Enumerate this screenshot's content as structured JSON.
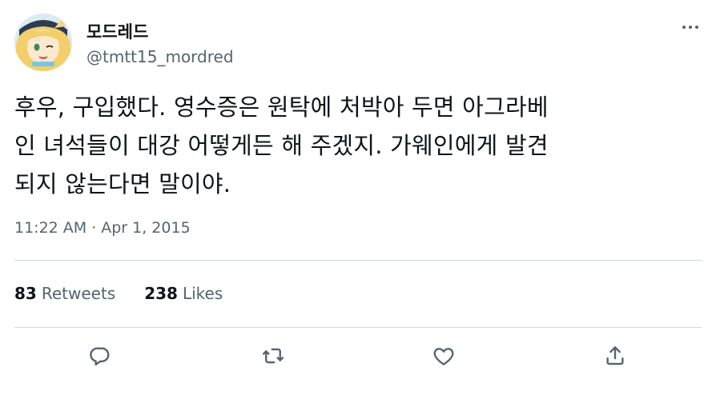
{
  "author": {
    "display_name": "모드레드",
    "handle": "@tmtt15_mordred"
  },
  "tweet": {
    "text_lines": [
      "후우, 구입했다. 영수증은 원탁에 처박아 두면 아그라베",
      "인 녀석들이 대강 어떻게든 해 주겠지. 가웨인에게 발견",
      "되지 않는다면 말이야."
    ],
    "time": "11:22 AM",
    "separator": "·",
    "date": "Apr 1, 2015"
  },
  "stats": {
    "retweets_count": "83",
    "retweets_label": "Retweets",
    "likes_count": "238",
    "likes_label": "Likes"
  },
  "actions": [
    "reply-icon",
    "retweet-icon",
    "like-icon",
    "share-icon"
  ],
  "colors": {
    "text_primary": "#0f1419",
    "text_secondary": "#536471",
    "divider": "#cfd9de"
  }
}
